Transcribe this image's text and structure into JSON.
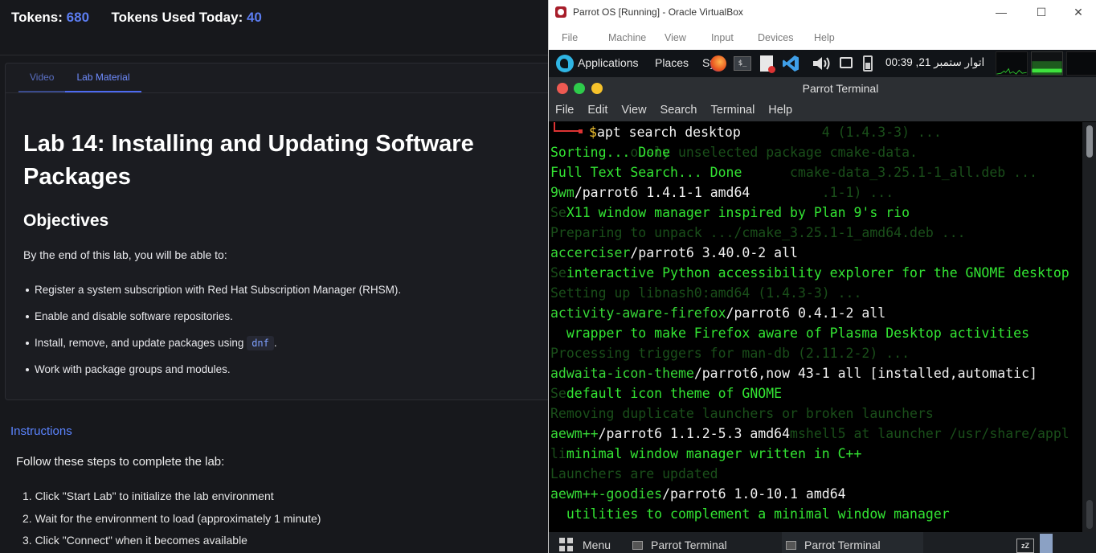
{
  "tokens": {
    "label": "Tokens:",
    "value": "680",
    "used_label": "Tokens Used Today:",
    "used_value": "40"
  },
  "tabs": [
    {
      "label": "Video"
    },
    {
      "label": "Lab Material"
    }
  ],
  "lab": {
    "title": "Lab 14: Installing and Updating Software Packages",
    "objectives_heading": "Objectives",
    "intro": "By the end of this lab, you will be able to:",
    "bullets": [
      "Register a system subscription with Red Hat Subscription Manager (RHSM).",
      "Enable and disable software repositories.",
      "Install, remove, and update packages using",
      "Work with package groups and modules."
    ],
    "code": "dnf",
    "bullet_suffix": "."
  },
  "instructions": {
    "heading": "Instructions",
    "intro": "Follow these steps to complete the lab:",
    "steps": [
      "1. Click \"Start Lab\" to initialize the lab environment",
      "2. Wait for the environment to load (approximately 1 minute)",
      "3. Click \"Connect\" when it becomes available"
    ]
  },
  "vbox": {
    "title": "Parrot OS [Running] - Oracle VirtualBox",
    "menu": [
      "File",
      "Machine",
      "View",
      "Input",
      "Devices",
      "Help"
    ],
    "win_buttons": {
      "minimize": "—",
      "maximize": "☐",
      "close": "✕"
    }
  },
  "guest_panel": {
    "applications": "Applications",
    "places": "Places",
    "system": "Sy",
    "clock": "اتوار ستمبر 21, 00:39",
    "term_icon": "$_"
  },
  "terminal": {
    "title": "Parrot Terminal",
    "menu": [
      "File",
      "Edit",
      "View",
      "Search",
      "Terminal",
      "Help"
    ],
    "command": "apt search desktop",
    "prompt_symbol": "$",
    "lines": [
      {
        "type": "plain",
        "text": "Sorting... Done"
      },
      {
        "type": "plain",
        "text": "Full Text Search... Done"
      },
      {
        "type": "pkg",
        "name": "9wm",
        "rest": "/parrot6 1.4.1-1 amd64"
      },
      {
        "type": "desc",
        "text": "  X11 window manager inspired by Plan 9's rio"
      },
      {
        "type": "blank",
        "text": ""
      },
      {
        "type": "pkg",
        "name": "accerciser",
        "rest": "/parrot6 3.40.0-2 all"
      },
      {
        "type": "desc",
        "text": "  interactive Python accessibility explorer for the GNOME desktop"
      },
      {
        "type": "blank",
        "text": ""
      },
      {
        "type": "pkg",
        "name": "activity-aware-firefox",
        "rest": "/parrot6 0.4.1-2 all"
      },
      {
        "type": "desc",
        "text": "  wrapper to make Firefox aware of Plasma Desktop activities"
      },
      {
        "type": "blank",
        "text": ""
      },
      {
        "type": "pkg",
        "name": "adwaita-icon-theme",
        "rest": "/parrot6,now 43-1 all [installed,automatic]"
      },
      {
        "type": "desc",
        "text": "  default icon theme of GNOME"
      },
      {
        "type": "blank",
        "text": ""
      },
      {
        "type": "pkg",
        "name": "aewm++",
        "rest": "/parrot6 1.1.2-5.3 amd64"
      },
      {
        "type": "desc",
        "text": "  minimal window manager written in C++"
      },
      {
        "type": "blank",
        "text": ""
      },
      {
        "type": "pkg",
        "name": "aewm++-goodies",
        "rest": "/parrot6 1.0-10.1 amd64"
      },
      {
        "type": "desc",
        "text": "  utilities to complement a minimal window manager"
      }
    ],
    "ghost_lines": [
      "                                  4 (1.4.3-3) ...",
      "       ...ously unselected package cmake-data.",
      "                              cmake-data_3.25.1-1_all.deb ...",
      "                                  .1-1) ...",
      "Se",
      "Preparing to unpack .../cmake_3.25.1-1_amd64.deb ...",
      "",
      "Se",
      "Setting up libnash0:amd64 (1.4.3-3) ...",
      "",
      "",
      "Processing triggers for man-db (2.11.2-2) ...",
      "",
      "Se",
      "Removing duplicate launchers or broken launchers",
      "                              mshell5 at launcher /usr/share/appl",
      "li",
      "Launchers are updated",
      "",
      "                 "
    ]
  },
  "taskbar": {
    "menu": "Menu",
    "items": [
      "Parrot Terminal",
      "Parrot Terminal"
    ],
    "zz": "zZ"
  }
}
